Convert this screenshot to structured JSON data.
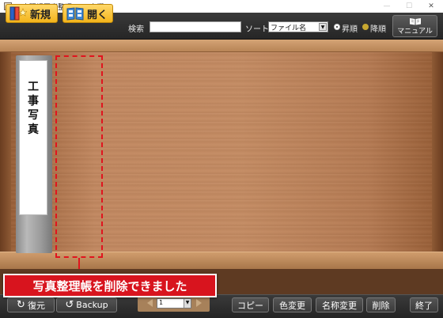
{
  "window": {
    "title": "工事現場写真整理 Lite 本棚",
    "controls": [
      "minimize",
      "maximize",
      "close"
    ]
  },
  "toolbar": {
    "new_label": "新規",
    "open_label": "開く",
    "search_label": "検索",
    "search_value": "",
    "sort_label": "ソート",
    "sort_value": "ファイル名",
    "ascending_label": "昇順",
    "descending_label": "降順",
    "ascending_selected": true,
    "manual_label": "マニュアル"
  },
  "shelf": {
    "binders": [
      {
        "title": "工事写真"
      }
    ]
  },
  "toast": {
    "message": "写真整理帳を削除できました"
  },
  "bottombar": {
    "restore_label": "復元",
    "backup_label": "Backup",
    "page_value": "1",
    "copy_label": "コピー",
    "color_change_label": "色変更",
    "rename_label": "名称変更",
    "delete_label": "削除",
    "exit_label": "終了"
  },
  "colors": {
    "accent_yellow": "#f3b51c",
    "toast_red": "#d8141e",
    "toolbar_dark": "#2e2e2e",
    "wood": "#c28860"
  },
  "icons": {
    "new": "new-binder-icon",
    "open": "open-book-icon",
    "manual": "manual-book-icon",
    "restore": "restore-arrow-icon",
    "backup": "backup-arrow-icon",
    "page_prev": "triangle-left-icon",
    "page_next": "triangle-right-icon"
  }
}
